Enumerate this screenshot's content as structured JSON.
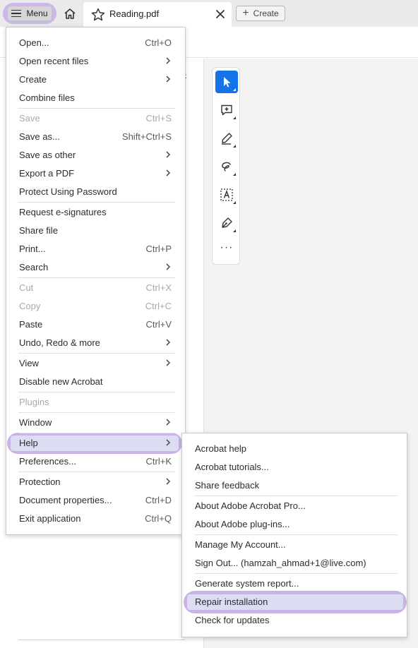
{
  "tabbar": {
    "menu_label": "Menu",
    "document_tab_title": "Reading.pdf",
    "create_label": "Create"
  },
  "colors": {
    "highlight_ring": "#c8b3e4",
    "highlight_fill": "#dcdcf3",
    "accent_blue": "#1473e6",
    "tab_bar_bg": "#eaeaea"
  },
  "icons": {
    "menu": "hamburger-icon",
    "home": "home-icon",
    "favorite": "star-icon",
    "close_tab": "close-icon",
    "create": "plus-icon",
    "submenu": "chevron-right-icon",
    "tools": [
      "select-cursor-icon",
      "add-comment-icon",
      "highlight-pen-icon",
      "draw-freehand-icon",
      "text-select-icon",
      "sign-icon",
      "more-options-icon"
    ]
  },
  "menu": {
    "items": [
      {
        "label": "Open...",
        "shortcut": "Ctrl+O"
      },
      {
        "label": "Open recent files",
        "submenu": true
      },
      {
        "label": "Create",
        "submenu": true
      },
      {
        "label": "Combine files"
      },
      {
        "label": "Save",
        "shortcut": "Ctrl+S",
        "disabled": true
      },
      {
        "label": "Save as...",
        "shortcut": "Shift+Ctrl+S"
      },
      {
        "label": "Save as other",
        "submenu": true
      },
      {
        "label": "Export a PDF",
        "submenu": true
      },
      {
        "label": "Protect Using Password"
      },
      {
        "label": "Request e-signatures"
      },
      {
        "label": "Share file"
      },
      {
        "label": "Print...",
        "shortcut": "Ctrl+P"
      },
      {
        "label": "Search",
        "submenu": true
      },
      {
        "label": "Cut",
        "shortcut": "Ctrl+X",
        "disabled": true
      },
      {
        "label": "Copy",
        "shortcut": "Ctrl+C",
        "disabled": true
      },
      {
        "label": "Paste",
        "shortcut": "Ctrl+V"
      },
      {
        "label": "Undo, Redo & more",
        "submenu": true
      },
      {
        "label": "View",
        "submenu": true
      },
      {
        "label": "Disable new Acrobat"
      },
      {
        "label": "Plugins",
        "disabled": true
      },
      {
        "label": "Window",
        "submenu": true
      },
      {
        "label": "Help",
        "submenu": true,
        "highlighted": true
      },
      {
        "label": "Preferences...",
        "shortcut": "Ctrl+K"
      },
      {
        "label": "Protection",
        "submenu": true
      },
      {
        "label": "Document properties...",
        "shortcut": "Ctrl+D"
      },
      {
        "label": "Exit application",
        "shortcut": "Ctrl+Q"
      }
    ]
  },
  "help_submenu": {
    "items": [
      {
        "label": "Acrobat help"
      },
      {
        "label": "Acrobat tutorials..."
      },
      {
        "label": "Share feedback"
      },
      {
        "label": "About Adobe Acrobat Pro..."
      },
      {
        "label": "About Adobe plug-ins..."
      },
      {
        "label": "Manage My Account..."
      },
      {
        "label": "Sign Out... (hamzah_ahmad+1@live.com)"
      },
      {
        "label": "Generate system report..."
      },
      {
        "label": "Repair installation",
        "highlighted": true
      },
      {
        "label": "Check for updates"
      }
    ]
  }
}
